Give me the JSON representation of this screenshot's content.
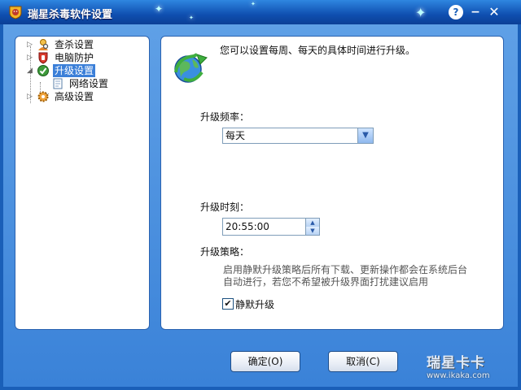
{
  "window": {
    "title": "瑞星杀毒软件设置",
    "help_glyph": "?",
    "minimize_glyph": "−",
    "close_glyph": "✕"
  },
  "tree": {
    "items": [
      {
        "label": "查杀设置",
        "icon": "search-person-icon"
      },
      {
        "label": "电脑防护",
        "icon": "shield-hand-icon"
      },
      {
        "label": "升级设置",
        "icon": "upgrade-icon",
        "selected": true
      },
      {
        "label": "网络设置",
        "icon": "document-icon"
      },
      {
        "label": "高级设置",
        "icon": "gear-icon"
      }
    ]
  },
  "content": {
    "intro": "您可以设置每周、每天的具体时间进行升级。",
    "frequency_label": "升级频率：",
    "frequency_value": "每天",
    "time_label": "升级时刻：",
    "time_value": "20:55:00",
    "strategy_label": "升级策略：",
    "strategy_desc_line1": "启用静默升级策略后所有下载、更新操作都会在系统后台",
    "strategy_desc_line2": "自动进行，若您不希望被升级界面打扰建议启用",
    "silent_label": "静默升级",
    "silent_checked": true
  },
  "buttons": {
    "ok": "确定(O)",
    "cancel": "取消(C)"
  },
  "watermark": {
    "brand": "瑞星卡卡",
    "url": "www.ikaka.com"
  },
  "colors": {
    "titlebar": "#0f4fb0",
    "client": "#4a90df",
    "selection": "#3b7fd8"
  }
}
